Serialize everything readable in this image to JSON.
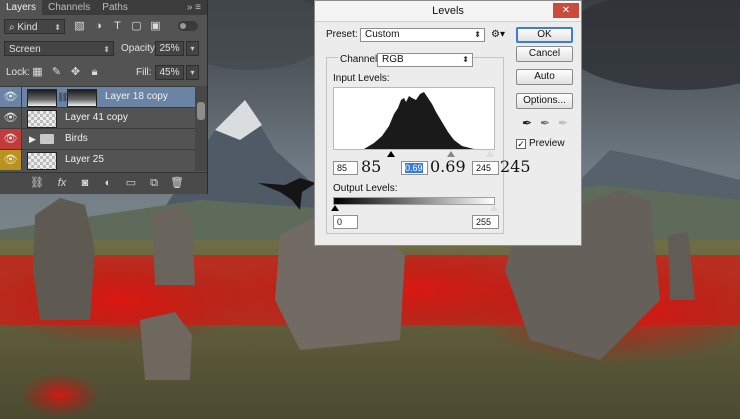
{
  "layers_panel": {
    "tabs": [
      "Layers",
      "Channels",
      "Paths"
    ],
    "filter_kind": "Kind",
    "blend_mode": "Screen",
    "opacity_label": "Opacity:",
    "opacity_value": "25%",
    "lock_label": "Lock:",
    "fill_label": "Fill:",
    "fill_value": "45%",
    "layers": [
      {
        "name": "Layer 18 copy",
        "selected": true,
        "eye_color": "none"
      },
      {
        "name": "Layer 41 copy",
        "selected": false,
        "eye_color": "none"
      },
      {
        "name": "Birds",
        "selected": false,
        "eye_color": "#c23b3b",
        "group": true
      },
      {
        "name": "Layer 25",
        "selected": false,
        "eye_color": "#b9931d"
      }
    ],
    "icons": [
      "link-icon",
      "fx-icon",
      "mask-icon",
      "adjustment-icon",
      "folder-icon",
      "new-layer-icon",
      "trash-icon"
    ]
  },
  "levels": {
    "title": "Levels",
    "preset_label": "Preset:",
    "preset_value": "Custom",
    "channel_label": "Channel:",
    "channel_value": "RGB",
    "input_levels_label": "Input Levels:",
    "output_levels_label": "Output Levels:",
    "input_black": "85",
    "input_gamma": "0.69",
    "input_white": "245",
    "overlay_black": "85",
    "overlay_gamma": "0.69",
    "overlay_white": "245",
    "output_black": "0",
    "output_white": "255",
    "buttons": {
      "ok": "OK",
      "cancel": "Cancel",
      "auto": "Auto",
      "options": "Options..."
    },
    "preview_label": "Preview",
    "preview_checked": true
  },
  "colors": {
    "panel_bg": "#535353",
    "selected_layer": "#6b84a4",
    "dialog_bg": "#ececec",
    "accent_blue": "#3a7bd5"
  }
}
